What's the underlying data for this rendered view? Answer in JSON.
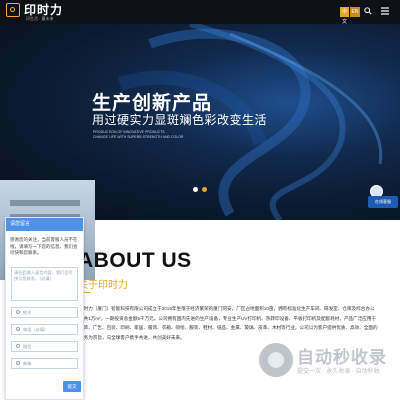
{
  "header": {
    "logo_text": "印时力",
    "logo_sub": "印生活 · 赢未来",
    "lang_cn": "中文",
    "lang_en": "EN",
    "search_icon": "search-icon",
    "menu_icon": "menu-icon"
  },
  "hero": {
    "title": "生产创新产品",
    "subtitle": "用过硬实力显斑斓色彩改变生活",
    "en_line1": "PRODUCTION OF INNOVATIVE PRODUCTS",
    "en_line2": "CHANGE LIFE WITH SUPERB STRENGTH AND COLOR",
    "slide_count": 2,
    "active_slide": 2
  },
  "service": {
    "label": "在线客服"
  },
  "about": {
    "title": "ABOUT US",
    "subtitle": "关于印时力",
    "text": "印时力（厦门）智能科技有限公司成立于2019年坐落于经济繁荣的厦门同安，厂区占地面积10亩，拥有标准化生产车间、研发室、仓库及综合办公室共1万m²，一期投资总金额5千万元。公司拥有国内先进的生产设备，专业生产UV打印机、热转印设备、平板打印机及配套耗材，产品广泛应用于装饰、广告、包装、印刷、家居、服饰、衣箱、喷绘、服装、鞋材、纸品、金属、玻璃、皮革、木材等行业。公司以为客户提供优质、高效、全面的服务为宗旨，与全球客户携手共进，共创美好未来。"
  },
  "chat": {
    "header": "请您留言",
    "message": "感谢您的关注，当前客服人员不在线，请填写一下您的信息，我们会尽快和您联系。",
    "textarea_placeholder": "请在此输入留言内容，我们会尽快与您联系。（必填）",
    "name_placeholder": "姓名",
    "phone_placeholder": "电话（必填）",
    "wechat_placeholder": "微信",
    "email_placeholder": "邮箱",
    "submit": "提交"
  },
  "watermark": {
    "text": "自动秒收录",
    "sub": "提交一次 · 永久收录 · 自动秒收"
  }
}
